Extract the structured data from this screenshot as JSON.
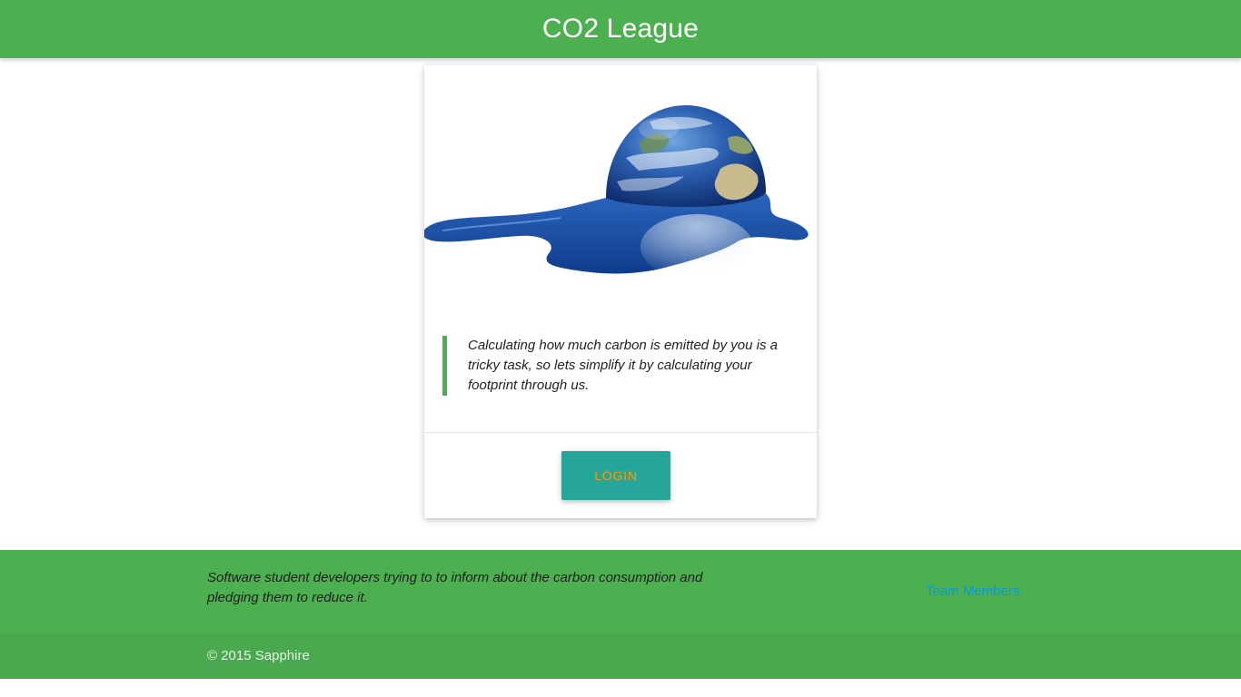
{
  "header": {
    "title": "CO2 League"
  },
  "card": {
    "image_icon": "melting-earth-image",
    "quote": "Calculating how much carbon is emitted by you is a tricky task, so lets simplify it by calculating your footprint through us.",
    "login_label": "Login"
  },
  "footer": {
    "description": "Software student developers trying to to inform about the carbon consumption and pledging them to reduce it.",
    "team_link": "Team Members",
    "copyright": "© 2015 Sapphire"
  },
  "colors": {
    "primary": "#4caf50",
    "footer_copyright_bg": "#4aa84e",
    "button_bg": "#26a69a",
    "button_text": "#ff9800",
    "link": "#039be5"
  }
}
